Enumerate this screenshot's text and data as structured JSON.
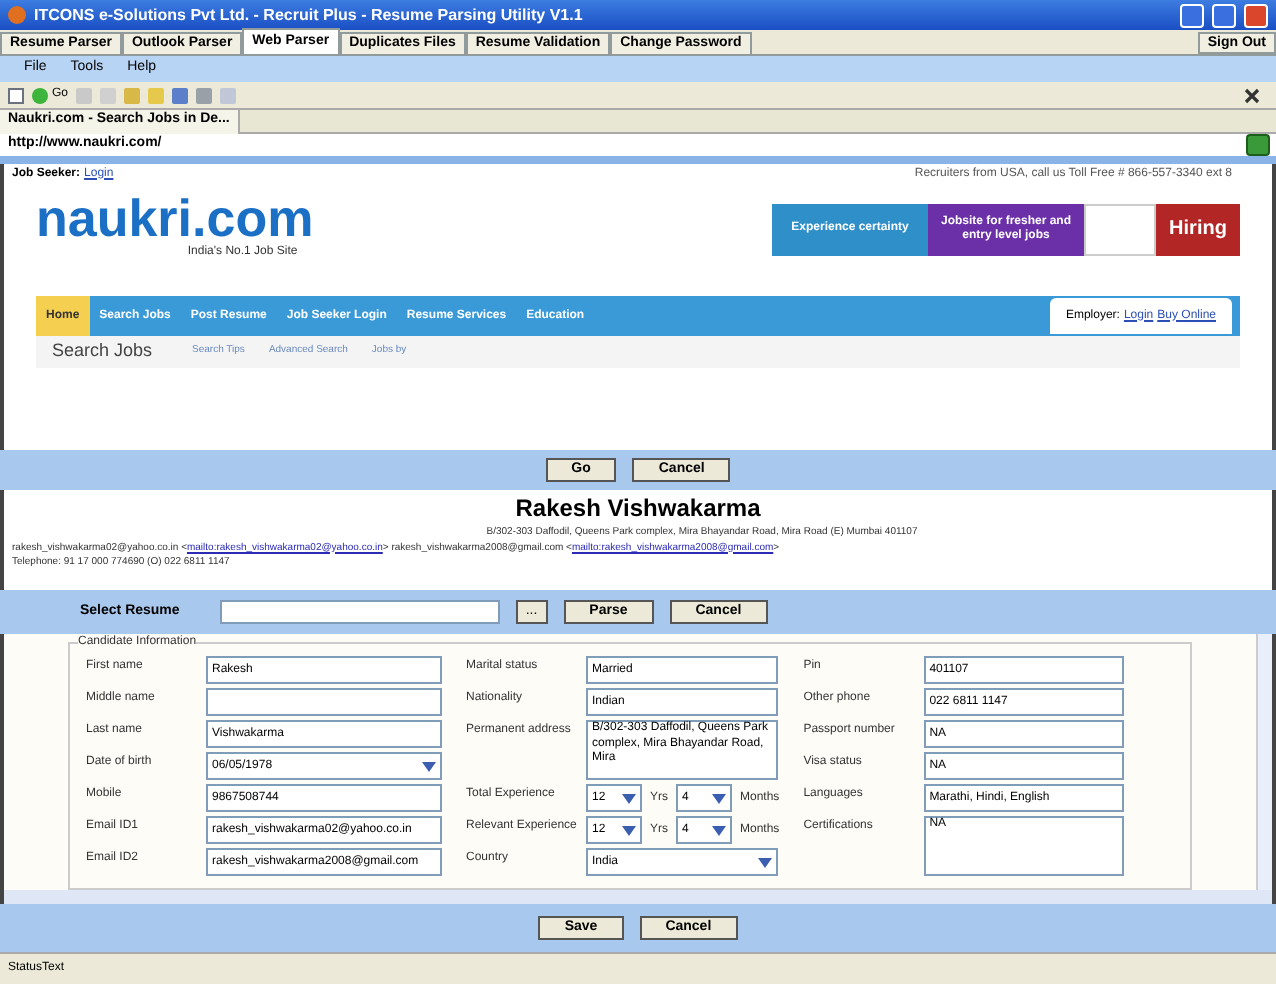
{
  "window": {
    "title": "ITCONS e-Solutions Pvt Ltd. - Recruit Plus - Resume Parsing Utility V1.1"
  },
  "tabs": [
    {
      "label": "Resume Parser",
      "selected": false
    },
    {
      "label": "Outlook Parser",
      "selected": false
    },
    {
      "label": "Web Parser",
      "selected": true
    },
    {
      "label": "Duplicates Files",
      "selected": false
    },
    {
      "label": "Resume Validation",
      "selected": false
    },
    {
      "label": "Change Password",
      "selected": false
    }
  ],
  "sign_out": "Sign Out",
  "menu": [
    "File",
    "Tools",
    "Help"
  ],
  "toolbar": {
    "go_label": "Go"
  },
  "browser": {
    "tab_title": "Naukri.com - Search Jobs in De...",
    "url": "http://www.naukri.com/",
    "page": {
      "job_seeker": "Job Seeker:",
      "login": "Login",
      "recruiters": "Recruiters from USA, call us Toll Free # 866-557-3340 ext 8",
      "logo": "naukri.com",
      "tagline": "India's No.1 Job Site",
      "ads": [
        {
          "text": "Experience certainty",
          "color": "#2f8fc8"
        },
        {
          "text": "Jobsite for fresher and entry level jobs",
          "color": "#6b2fa8"
        },
        {
          "text": "Hiring",
          "color": "#b32626"
        }
      ],
      "nav": [
        {
          "label": "Home",
          "selected": true
        },
        {
          "label": "Search Jobs",
          "selected": false
        },
        {
          "label": "Post Resume",
          "selected": false
        },
        {
          "label": "Job Seeker Login",
          "selected": false
        },
        {
          "label": "Resume Services",
          "selected": false
        },
        {
          "label": "Education",
          "selected": false
        }
      ],
      "employer": "Employer:",
      "employer_links": [
        "Login",
        "Buy Online"
      ],
      "search_title": "Search Jobs",
      "search_links": [
        "Search Tips",
        "Advanced Search",
        "Jobs by"
      ]
    }
  },
  "browser_buttons": [
    "Go",
    "Cancel"
  ],
  "resume": {
    "name": "Rakesh Vishwakarma",
    "address": "B/302-303 Daffodil, Queens Park complex, Mira Bhayandar Road, Mira Road (E) Mumbai 401107",
    "email_text_1": "rakesh_vishwakarma02@yahoo.co.in <",
    "email_link_1": "mailto:rakesh_vishwakarma02@yahoo.co.in",
    "email_text_2": "> rakesh_vishwakarma2008@gmail.com <",
    "email_link_2": "mailto:rakesh_vishwakarma2008@gmail.com",
    "email_text_3": ">",
    "telephone": "Telephone: 91 17 000 774690 (O) 022 6811 1147"
  },
  "select_resume": {
    "label": "Select Resume",
    "browse": "...",
    "buttons": [
      "Parse",
      "Cancel"
    ]
  },
  "candidate": {
    "legend": "Candidate Information",
    "col1": [
      {
        "label": "First name",
        "value": "Rakesh",
        "kind": "text"
      },
      {
        "label": "Middle name",
        "kind": "text"
      },
      {
        "label": "Last name",
        "value": "Vishwakarma",
        "kind": "text"
      },
      {
        "label": "Date of birth",
        "value": "06/05/1978",
        "kind": "dropdown"
      },
      {
        "label": "Mobile",
        "value": "9867508744",
        "kind": "text"
      },
      {
        "label": "Email ID1",
        "value": "rakesh_vishwakarma02@yahoo.co.in",
        "kind": "text"
      },
      {
        "label": "Email ID2",
        "value": "rakesh_vishwakarma2008@gmail.com",
        "kind": "text"
      }
    ],
    "col2": [
      {
        "label": "Marital status",
        "value": "Married",
        "kind": "text"
      },
      {
        "label": "Nationality",
        "value": "Indian",
        "kind": "text"
      },
      {
        "label": "Permanent address",
        "value": "B/302-303 Daffodil, Queens Park complex, Mira Bhayandar Road, Mira",
        "kind": "area"
      },
      {
        "label": "Total Experience",
        "years": "12",
        "years_unit": "Yrs",
        "months": "4",
        "months_unit": "Months",
        "kind": "experience"
      },
      {
        "label": "Relevant Experience",
        "years": "12",
        "years_unit": "Yrs",
        "months": "4",
        "months_unit": "Months",
        "kind": "experience"
      },
      {
        "label": "Country",
        "value": "India",
        "kind": "dropdown"
      }
    ],
    "col3": [
      {
        "label": "Pin",
        "value": "401107",
        "kind": "text"
      },
      {
        "label": "Other phone",
        "value": "022 6811 1147",
        "kind": "text"
      },
      {
        "label": "Passport number",
        "value": "NA",
        "kind": "text"
      },
      {
        "label": "Visa status",
        "value": "NA",
        "kind": "text"
      },
      {
        "label": "Languages",
        "value": "Marathi, Hindi, English",
        "kind": "text"
      },
      {
        "label": "Certifications",
        "value": "NA",
        "kind": "area"
      }
    ]
  },
  "bottom_buttons": [
    "Save",
    "Cancel"
  ],
  "status_bar": "StatusText"
}
